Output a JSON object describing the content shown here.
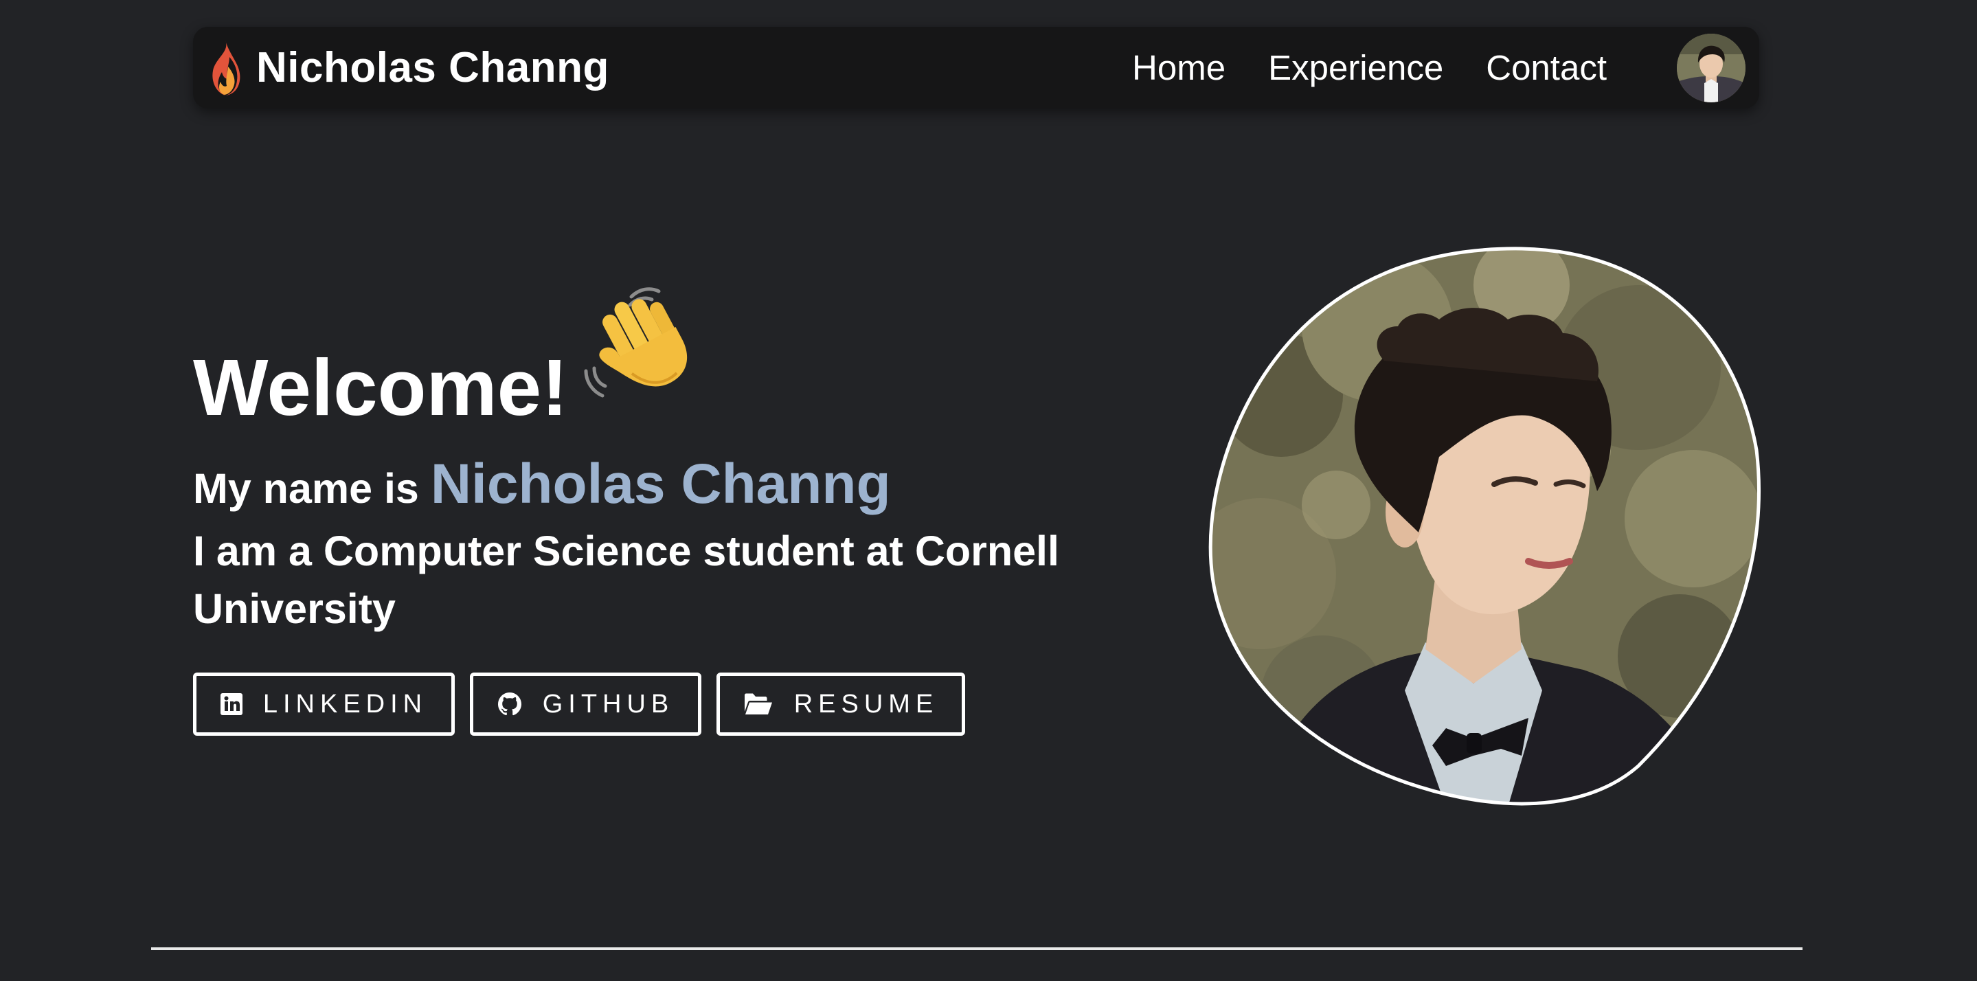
{
  "navbar": {
    "brand_icon": "flame-icon",
    "brand_name": "Nicholas Channg",
    "links": [
      {
        "label": "Home"
      },
      {
        "label": "Experience"
      },
      {
        "label": "Contact"
      }
    ],
    "avatar_icon": "avatar"
  },
  "hero": {
    "title": "Welcome!",
    "title_icon": "waving-hand-icon",
    "intro_prefix": "My name is",
    "name": "Nicholas Channg",
    "tagline": "I am a Computer Science student at Cornell University"
  },
  "buttons": [
    {
      "label": "LINKEDIN",
      "icon": "linkedin-icon"
    },
    {
      "label": "GITHUB",
      "icon": "github-icon"
    },
    {
      "label": "RESUME",
      "icon": "folder-open-icon"
    }
  ],
  "colors": {
    "background": "#222326",
    "navbar": "#161617",
    "name_accent": "#9db3cf",
    "text": "#ffffff"
  }
}
